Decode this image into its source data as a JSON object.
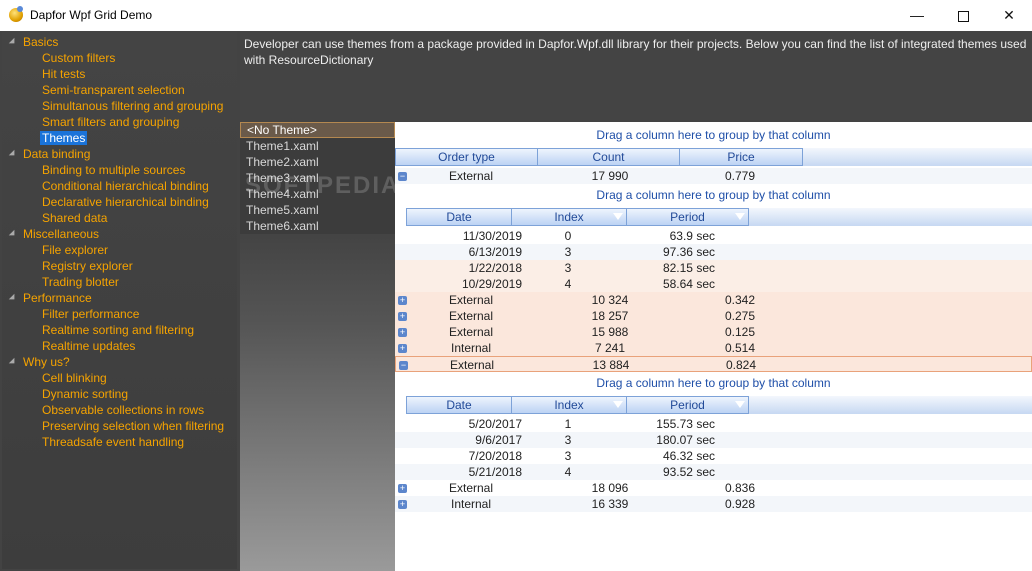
{
  "window": {
    "title": "Dapfor Wpf Grid Demo",
    "minimize": "—",
    "close": "✕"
  },
  "tree": [
    {
      "label": "Basics",
      "type": "group"
    },
    {
      "label": "Custom filters",
      "type": "child"
    },
    {
      "label": "Hit tests",
      "type": "child"
    },
    {
      "label": "Semi-transparent selection",
      "type": "child"
    },
    {
      "label": "Simultanous filtering and grouping",
      "type": "child"
    },
    {
      "label": "Smart filters and grouping",
      "type": "child"
    },
    {
      "label": "Themes",
      "type": "child",
      "selected": true
    },
    {
      "label": "Data binding",
      "type": "group"
    },
    {
      "label": "Binding to multiple sources",
      "type": "child"
    },
    {
      "label": "Conditional hierarchical binding",
      "type": "child"
    },
    {
      "label": "Declarative hierarchical binding",
      "type": "child"
    },
    {
      "label": "Shared data",
      "type": "child"
    },
    {
      "label": "Miscellaneous",
      "type": "group"
    },
    {
      "label": "File explorer",
      "type": "child"
    },
    {
      "label": "Registry explorer",
      "type": "child"
    },
    {
      "label": "Trading blotter",
      "type": "child"
    },
    {
      "label": "Performance",
      "type": "group"
    },
    {
      "label": "Filter performance",
      "type": "child"
    },
    {
      "label": "Realtime sorting and filtering",
      "type": "child"
    },
    {
      "label": "Realtime updates",
      "type": "child"
    },
    {
      "label": "Why us?",
      "type": "group"
    },
    {
      "label": "Cell blinking",
      "type": "child"
    },
    {
      "label": "Dynamic sorting",
      "type": "child"
    },
    {
      "label": "Observable collections in rows",
      "type": "child"
    },
    {
      "label": "Preserving selection when filtering",
      "type": "child"
    },
    {
      "label": "Threadsafe event handling",
      "type": "child"
    }
  ],
  "description": "Developer can use themes from a package provided in Dapfor.Wpf.dll library for their projects. Below you can find the list of integrated themes used with ResourceDictionary",
  "themes": [
    "<No Theme>",
    "Theme1.xaml",
    "Theme2.xaml",
    "Theme3.xaml",
    "Theme4.xaml",
    "Theme5.xaml",
    "Theme6.xaml"
  ],
  "watermark": "SOFTPEDIA",
  "grid": {
    "group_hint": "Drag a column here to group by that column",
    "top_headers": [
      "Order type",
      "Count",
      "Price"
    ],
    "sub_headers": [
      "Date",
      "Index",
      "Period"
    ],
    "expand_open": "−",
    "expand_closed": "+",
    "order1": {
      "type": "External",
      "count": "17 990",
      "price": "0.779"
    },
    "sub1": [
      {
        "date": "11/30/2019",
        "index": "0",
        "period": "63.9 sec"
      },
      {
        "date": "6/13/2019",
        "index": "3",
        "period": "97.36 sec"
      },
      {
        "date": "1/22/2018",
        "index": "3",
        "period": "82.15 sec"
      },
      {
        "date": "10/29/2019",
        "index": "4",
        "period": "58.64 sec"
      }
    ],
    "orders_mid": [
      {
        "type": "External",
        "count": "10 324",
        "price": "0.342"
      },
      {
        "type": "External",
        "count": "18 257",
        "price": "0.275"
      },
      {
        "type": "External",
        "count": "15 988",
        "price": "0.125"
      },
      {
        "type": "Internal",
        "count": "7 241",
        "price": "0.514"
      }
    ],
    "order6": {
      "type": "External",
      "count": "13 884",
      "price": "0.824"
    },
    "sub2": [
      {
        "date": "5/20/2017",
        "index": "1",
        "period": "155.73 sec"
      },
      {
        "date": "9/6/2017",
        "index": "3",
        "period": "180.07 sec"
      },
      {
        "date": "7/20/2018",
        "index": "3",
        "period": "46.32 sec"
      },
      {
        "date": "5/21/2018",
        "index": "4",
        "period": "93.52 sec"
      }
    ],
    "orders_end": [
      {
        "type": "External",
        "count": "18 096",
        "price": "0.836"
      },
      {
        "type": "Internal",
        "count": "16 339",
        "price": "0.928"
      }
    ]
  }
}
